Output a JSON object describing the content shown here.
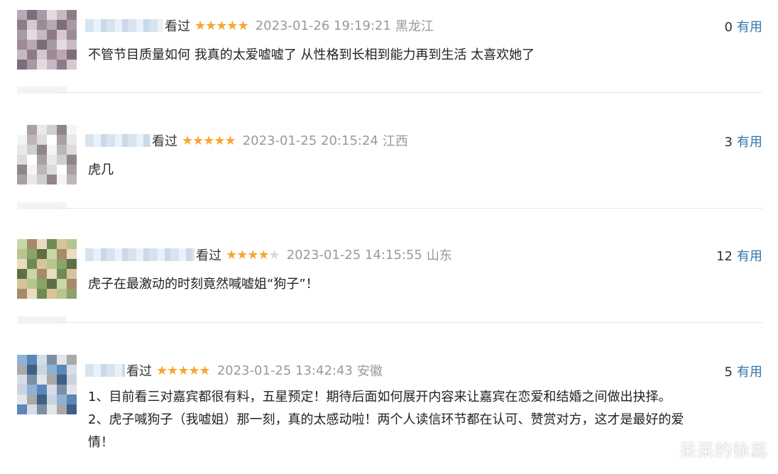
{
  "reviews": [
    {
      "watched": "看过",
      "stars": 5,
      "stars_text": "★★★★★",
      "stars_off": "",
      "time": "2023-01-26 19:19:21",
      "location": "黑龙江",
      "useful_count": "0",
      "useful_label": "有用",
      "lines": [
        "不管节目质量如何 我真的太爱嘘嘘了 从性格到长相到能力再到生活 太喜欢她了"
      ]
    },
    {
      "watched": "看过",
      "stars": 5,
      "stars_text": "★★★★★",
      "stars_off": "",
      "time": "2023-01-25 20:15:24",
      "location": "江西",
      "useful_count": "3",
      "useful_label": "有用",
      "lines": [
        "虎几"
      ]
    },
    {
      "watched": "看过",
      "stars": 4,
      "stars_text": "★★★★",
      "stars_off": "★",
      "time": "2023-01-25 14:15:55",
      "location": "山东",
      "useful_count": "12",
      "useful_label": "有用",
      "lines": [
        "虎子在最激动的时刻竟然喊嘘姐“狗子”！"
      ]
    },
    {
      "watched": "看过",
      "stars": 5,
      "stars_text": "★★★★★",
      "stars_off": "",
      "time": "2023-01-25 13:42:43",
      "location": "安徽",
      "useful_count": "5",
      "useful_label": "有用",
      "lines": [
        "1、目前看三对嘉宾都很有料，五星预定！期待后面如何展开内容来让嘉宾在恋爱和结婚之间做出抉择。",
        "2、虎子喊狗子（我嘘姐）那一刻，真的太感动啦！两个人读信环节都在认可、赞赏对方，这才是最好的爱",
        "情！"
      ]
    }
  ],
  "watermark": "呆呆的徐蕊",
  "colors": {
    "star": "#f7a72f",
    "useful_link": "#3377aa",
    "meta_gray": "#999999"
  }
}
